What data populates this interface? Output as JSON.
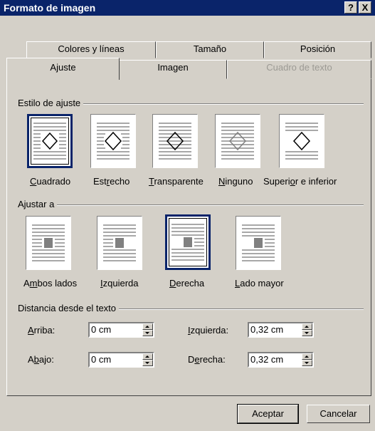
{
  "dialog": {
    "title": "Formato de imagen"
  },
  "titlebar": {
    "help_label": "?",
    "close_label": "X"
  },
  "tabs": {
    "row1": [
      {
        "label": "Colores y líneas"
      },
      {
        "label": "Tamaño"
      },
      {
        "label": "Posición"
      }
    ],
    "row2": [
      {
        "label": "Ajuste",
        "active": true
      },
      {
        "label": "Imagen"
      },
      {
        "label": "Cuadro de texto",
        "disabled": true
      }
    ]
  },
  "wrap_style": {
    "label": "Estilo de ajuste",
    "options": [
      {
        "pre": "",
        "key": "C",
        "post": "uadrado",
        "selected": true
      },
      {
        "pre": "Est",
        "key": "r",
        "post": "echo"
      },
      {
        "pre": "",
        "key": "T",
        "post": "ransparente"
      },
      {
        "pre": "",
        "key": "N",
        "post": "inguno"
      },
      {
        "pre": "Superi",
        "key": "o",
        "post": "r e inferior"
      }
    ]
  },
  "wrap_to": {
    "label": "Ajustar a",
    "options": [
      {
        "pre": "A",
        "key": "m",
        "post": "bos lados"
      },
      {
        "pre": "",
        "key": "I",
        "post": "zquierda"
      },
      {
        "pre": "",
        "key": "D",
        "post": "erecha",
        "selected": true
      },
      {
        "pre": "",
        "key": "L",
        "post": "ado mayor"
      }
    ]
  },
  "distance": {
    "label": "Distancia desde el texto",
    "top": {
      "pre": "",
      "key": "A",
      "post": "rriba:",
      "value": "0 cm"
    },
    "bottom": {
      "pre": "A",
      "key": "b",
      "post": "ajo:",
      "value": "0 cm"
    },
    "left": {
      "pre": "",
      "key": "I",
      "post": "zquierda:",
      "value": "0,32 cm"
    },
    "right": {
      "pre": "D",
      "key": "e",
      "post": "recha:",
      "value": "0,32 cm"
    }
  },
  "buttons": {
    "ok": "Aceptar",
    "cancel": "Cancelar"
  }
}
